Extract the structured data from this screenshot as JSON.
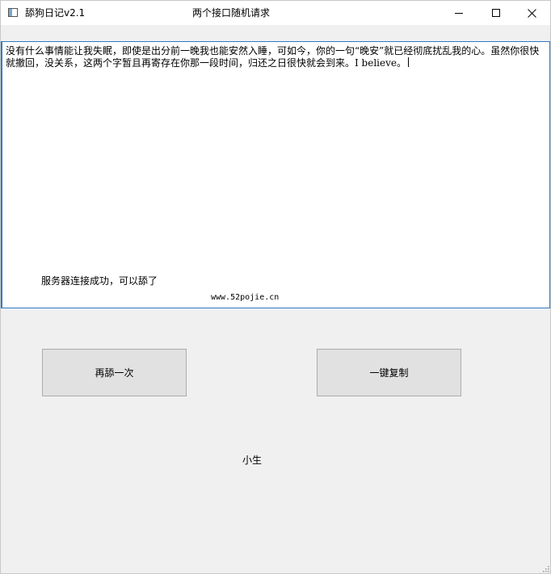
{
  "window": {
    "app_title": "舔狗日记v2.1",
    "heading": "两个接口随机请求",
    "controls": {
      "minimize_icon": "minimize-icon",
      "maximize_icon": "maximize-icon",
      "close_icon": "close-icon"
    }
  },
  "content": {
    "message": "没有什么事情能让我失眠，即使是出分前一晚我也能安然入睡，可如今，你的一句“晚安”就已经彻底扰乱我的心。虽然你很快就撤回，没关系，这两个字暂且再寄存在你那一段时间，归还之日很快就会到来。I believe。",
    "status": "服务器连接成功，可以舔了",
    "site": "www.52pojie.cn"
  },
  "buttons": {
    "again_label": "再舔一次",
    "copy_label": "一键复制"
  },
  "footer": {
    "author": "小生"
  },
  "colors": {
    "focus_border": "#2f7bc3",
    "button_face": "#e1e1e1",
    "window_bg": "#f0f0f0"
  }
}
